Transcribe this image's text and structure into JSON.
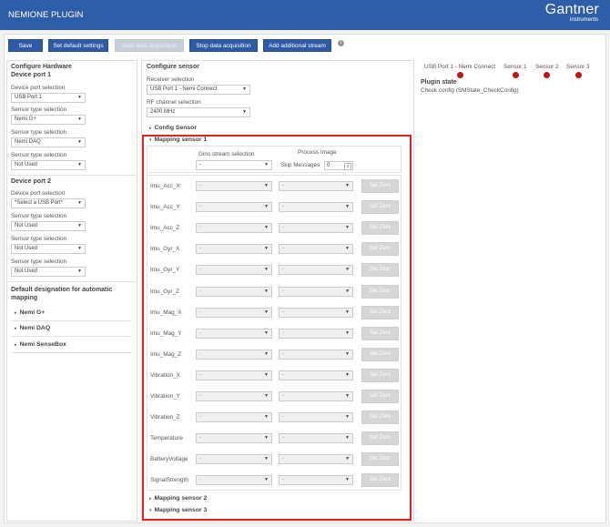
{
  "header": {
    "title": "NEMIONE PLUGIN",
    "brand_name": "Gantner",
    "brand_sub": "instruments"
  },
  "toolbar": {
    "save": "Save",
    "set_default": "Set default settings",
    "start_acq": "Start data acquisition",
    "stop_acq": "Stop data acquisition",
    "add_stream": "Add additional stream",
    "info_icon": "i"
  },
  "hardware": {
    "title": "Configure Hardware",
    "port1": {
      "title": "Device port 1",
      "port_label": "Device port selection",
      "port_value": "USB Port 1",
      "sensors": [
        {
          "label": "Sensor type selection",
          "value": "Nemi G+"
        },
        {
          "label": "Sensor type selection",
          "value": "Nemi DAQ"
        },
        {
          "label": "Sensor type selection",
          "value": "Not Used"
        }
      ]
    },
    "port2": {
      "title": "Device port 2",
      "port_label": "Device port selection",
      "port_value": "*Select a USB Port*",
      "sensors": [
        {
          "label": "Sensor type selection",
          "value": "Not Used"
        },
        {
          "label": "Sensor type selection",
          "value": "Not Used"
        },
        {
          "label": "Sensor type selection",
          "value": "Not Used"
        }
      ]
    },
    "default_title": "Default designation for automatic mapping",
    "default_items": [
      "Nemi G+",
      "Nemi DAQ",
      "Nemi SenseBox"
    ]
  },
  "sensor": {
    "title": "Configure sensor",
    "receiver_label": "Receiver selection",
    "receiver_value": "USB Port 1 - Nemi Connect",
    "rf_label": "RF channel selection",
    "rf_value": "2400 MHz",
    "config_sensor": "Config Sensor",
    "mapping1": "Mapping sensor 1",
    "mapping2": "Mapping sensor 2",
    "mapping3": "Mapping sensor 3",
    "stream_label": "Gins stream selection",
    "stream_value": "-",
    "process_label": "Process Image",
    "skip_label": "Skip Messages",
    "skip_value": "0",
    "set_zero": "Set Zero",
    "dash": "-",
    "rows": [
      "Imu_Acc_X",
      "Imu_Acc_Y",
      "Imu_Acc_Z",
      "Imu_Gyr_X",
      "Imu_Gyr_Y",
      "Imu_Gyr_Z",
      "Imu_Mag_X",
      "Imu_Mag_Y",
      "Imu_Mag_Z",
      "Vibration_X",
      "Vibration_Y",
      "Vibration_Z",
      "Temperature",
      "BatteryVoltage",
      "SignalStrength"
    ]
  },
  "plugin": {
    "devices": [
      "USB Port 1 - Nemi Connect",
      "Sensor 1",
      "Sensor 2",
      "Sensor 3"
    ],
    "state_title": "Plugin state",
    "state_value": "Check config (SMState_CheckConfig)",
    "status_color": "#c0141b"
  }
}
